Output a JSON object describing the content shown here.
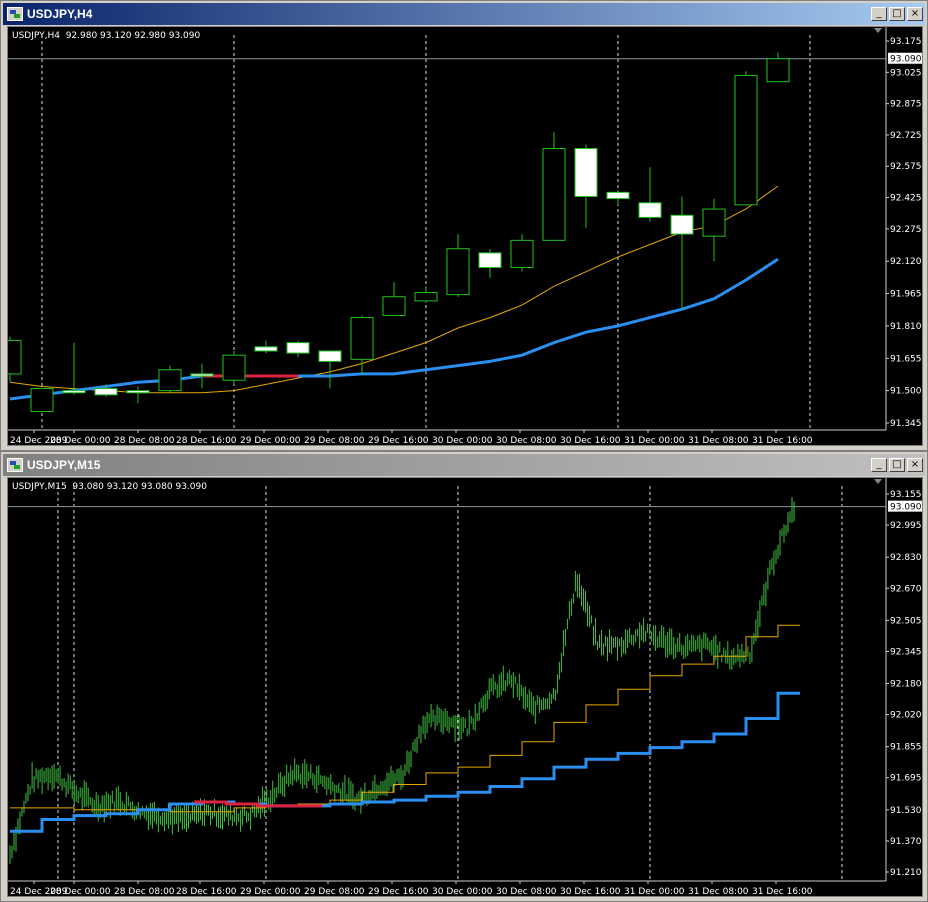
{
  "windows": [
    {
      "title": "USDJPY,H4",
      "info": "USDJPY,H4  92.980 93.120 92.980 93.090",
      "price_tag": "93.090",
      "buttons": {
        "minimize": "_",
        "restore": "□",
        "close": "×"
      }
    },
    {
      "title": "USDJPY,M15",
      "info": "USDJPY,M15  93.080 93.120 93.080 93.090",
      "price_tag": "93.090",
      "buttons": {
        "minimize": "_",
        "restore": "□",
        "close": "×"
      }
    }
  ],
  "chart_data": [
    {
      "type": "candlestick",
      "symbol": "USDJPY",
      "timeframe": "H4",
      "ylim": [
        91.345,
        93.175
      ],
      "y_ticks": [
        93.175,
        93.025,
        92.875,
        92.725,
        92.575,
        92.425,
        92.275,
        92.12,
        91.965,
        91.81,
        91.655,
        91.5,
        91.345
      ],
      "x_tick_labels": [
        "24 Dec 2009",
        "28 Dec 00:00",
        "28 Dec 08:00",
        "28 Dec 16:00",
        "29 Dec 00:00",
        "29 Dec 08:00",
        "29 Dec 16:00",
        "30 Dec 00:00",
        "30 Dec 08:00",
        "30 Dec 16:00",
        "31 Dec 00:00",
        "31 Dec 08:00",
        "31 Dec 16:00"
      ],
      "current_price": 93.09,
      "candles": [
        {
          "o": 91.58,
          "h": 91.76,
          "l": 91.54,
          "c": 91.74
        },
        {
          "o": 91.4,
          "h": 91.51,
          "l": 91.4,
          "c": 91.51
        },
        {
          "o": 91.5,
          "h": 91.73,
          "l": 91.48,
          "c": 91.49
        },
        {
          "o": 91.51,
          "h": 91.53,
          "l": 91.47,
          "c": 91.48
        },
        {
          "o": 91.5,
          "h": 91.52,
          "l": 91.44,
          "c": 91.49
        },
        {
          "o": 91.5,
          "h": 91.62,
          "l": 91.49,
          "c": 91.6
        },
        {
          "o": 91.58,
          "h": 91.63,
          "l": 91.51,
          "c": 91.57
        },
        {
          "o": 91.55,
          "h": 91.69,
          "l": 91.53,
          "c": 91.67
        },
        {
          "o": 91.71,
          "h": 91.74,
          "l": 91.68,
          "c": 91.69
        },
        {
          "o": 91.73,
          "h": 91.74,
          "l": 91.66,
          "c": 91.68
        },
        {
          "o": 91.69,
          "h": 91.69,
          "l": 91.51,
          "c": 91.64
        },
        {
          "o": 91.65,
          "h": 91.86,
          "l": 91.58,
          "c": 91.85
        },
        {
          "o": 91.86,
          "h": 92.02,
          "l": 91.86,
          "c": 91.95
        },
        {
          "o": 91.93,
          "h": 92.0,
          "l": 91.92,
          "c": 91.97
        },
        {
          "o": 91.96,
          "h": 92.25,
          "l": 91.95,
          "c": 92.18
        },
        {
          "o": 92.16,
          "h": 92.18,
          "l": 92.04,
          "c": 92.09
        },
        {
          "o": 92.09,
          "h": 92.25,
          "l": 92.07,
          "c": 92.22
        },
        {
          "o": 92.22,
          "h": 92.74,
          "l": 92.22,
          "c": 92.66
        },
        {
          "o": 92.66,
          "h": 92.68,
          "l": 92.28,
          "c": 92.43
        },
        {
          "o": 92.45,
          "h": 92.46,
          "l": 92.39,
          "c": 92.42
        },
        {
          "o": 92.4,
          "h": 92.57,
          "l": 92.31,
          "c": 92.33
        },
        {
          "o": 92.34,
          "h": 92.43,
          "l": 91.89,
          "c": 92.25
        },
        {
          "o": 92.24,
          "h": 92.42,
          "l": 92.12,
          "c": 92.37
        },
        {
          "o": 92.39,
          "h": 93.03,
          "l": 92.39,
          "c": 93.01
        },
        {
          "o": 92.98,
          "h": 93.12,
          "l": 92.98,
          "c": 93.09
        }
      ],
      "ma_fast": [
        91.54,
        91.52,
        91.51,
        91.5,
        91.49,
        91.49,
        91.49,
        91.5,
        91.53,
        91.56,
        91.59,
        91.63,
        91.68,
        91.73,
        91.8,
        91.85,
        91.91,
        92.0,
        92.07,
        92.14,
        92.2,
        92.26,
        92.29,
        92.37,
        92.48
      ],
      "ma_slow": [
        91.46,
        91.48,
        91.5,
        91.52,
        91.54,
        91.55,
        91.57,
        91.57,
        91.57,
        91.57,
        91.57,
        91.58,
        91.58,
        91.6,
        91.62,
        91.64,
        91.67,
        91.73,
        91.78,
        91.81,
        91.85,
        91.89,
        91.94,
        92.03,
        92.13
      ],
      "ma_slow_red_range": [
        6,
        9
      ]
    },
    {
      "type": "bar",
      "symbol": "USDJPY",
      "timeframe": "M15",
      "ylim": [
        91.21,
        93.155
      ],
      "y_ticks": [
        93.155,
        92.995,
        92.83,
        92.67,
        92.505,
        92.345,
        92.18,
        92.02,
        91.855,
        91.695,
        91.53,
        91.37,
        91.21
      ],
      "x_tick_labels": [
        "24 Dec 2009",
        "28 Dec 00:00",
        "28 Dec 08:00",
        "28 Dec 16:00",
        "29 Dec 00:00",
        "29 Dec 08:00",
        "29 Dec 16:00",
        "30 Dec 00:00",
        "30 Dec 08:00",
        "30 Dec 16:00",
        "31 Dec 00:00",
        "31 Dec 08:00",
        "31 Dec 16:00"
      ],
      "current_price": 93.09,
      "price_path": [
        91.3,
        91.68,
        91.72,
        91.62,
        91.55,
        91.58,
        91.52,
        91.5,
        91.48,
        91.52,
        91.5,
        91.5,
        91.6,
        91.72,
        91.7,
        91.64,
        91.58,
        91.66,
        91.7,
        91.98,
        92.0,
        91.95,
        92.14,
        92.2,
        92.05,
        92.12,
        92.72,
        92.38,
        92.38,
        92.45,
        92.4,
        92.36,
        92.38,
        92.31,
        92.34,
        92.8,
        93.09
      ],
      "ma_fast_steps": [
        91.54,
        91.54,
        91.53,
        91.53,
        91.53,
        91.52,
        91.52,
        91.54,
        91.55,
        91.56,
        91.58,
        91.62,
        91.66,
        91.72,
        91.75,
        91.81,
        91.88,
        91.98,
        92.07,
        92.15,
        92.22,
        92.28,
        92.32,
        92.42,
        92.48
      ],
      "ma_slow_steps": [
        91.42,
        91.48,
        91.5,
        91.51,
        91.53,
        91.56,
        91.57,
        91.56,
        91.55,
        91.55,
        91.56,
        91.57,
        91.58,
        91.6,
        91.62,
        91.65,
        91.69,
        91.75,
        91.79,
        91.82,
        91.85,
        91.88,
        91.92,
        92.0,
        92.13
      ],
      "ma_slow_red_range": [
        6,
        9
      ]
    }
  ]
}
